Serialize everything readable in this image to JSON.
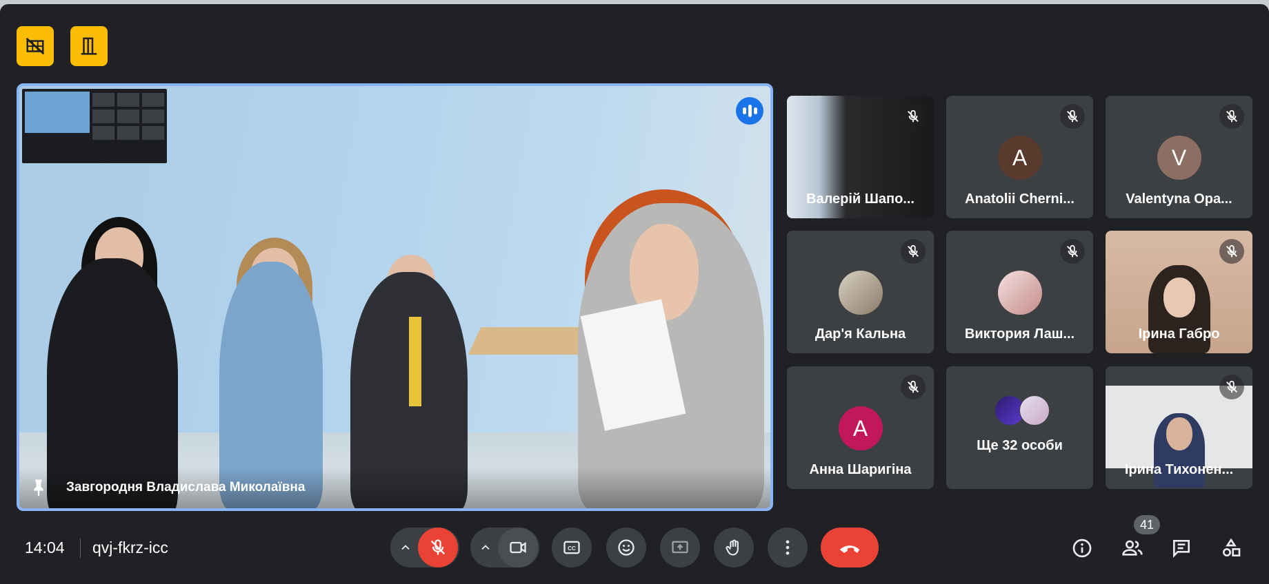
{
  "top_buttons": [
    {
      "icon": "no-video-grid-icon"
    },
    {
      "icon": "door-exit-icon"
    }
  ],
  "main_speaker": {
    "name": "Завгородня Владислава Миколаївна",
    "speaking_indicator": "audio-level-icon",
    "pinned": true
  },
  "participants": [
    {
      "name": "Валерій Шапо...",
      "muted": true,
      "display": "video"
    },
    {
      "name": "Anatolii Cherni...",
      "muted": true,
      "display": "initial",
      "initial": "A",
      "color": "#5b3a2e"
    },
    {
      "name": "Valentyna Opa...",
      "muted": true,
      "display": "initial",
      "initial": "V",
      "color": "#8d6e63"
    },
    {
      "name": "Дар'я Кальна",
      "muted": true,
      "display": "photo"
    },
    {
      "name": "Виктория Лаш...",
      "muted": true,
      "display": "photo"
    },
    {
      "name": "Ірина Габро",
      "muted": true,
      "display": "video"
    },
    {
      "name": "Анна Шаригіна",
      "muted": true,
      "display": "initial",
      "initial": "A",
      "color": "#c2185b"
    },
    {
      "name": "Ірина Тихонен...",
      "muted": true,
      "display": "video"
    }
  ],
  "more_tile": {
    "label": "Ще 32 особи"
  },
  "bottom_bar": {
    "time": "14:04",
    "meeting_code": "qvj-fkrz-icc",
    "people_count": "41"
  },
  "colors": {
    "background": "#202124",
    "tile": "#3c4043",
    "accent_yellow": "#fbbc04",
    "speaking_blue": "#1a73e8",
    "danger_red": "#ea4335",
    "highlight_border": "#8ab4f8"
  }
}
